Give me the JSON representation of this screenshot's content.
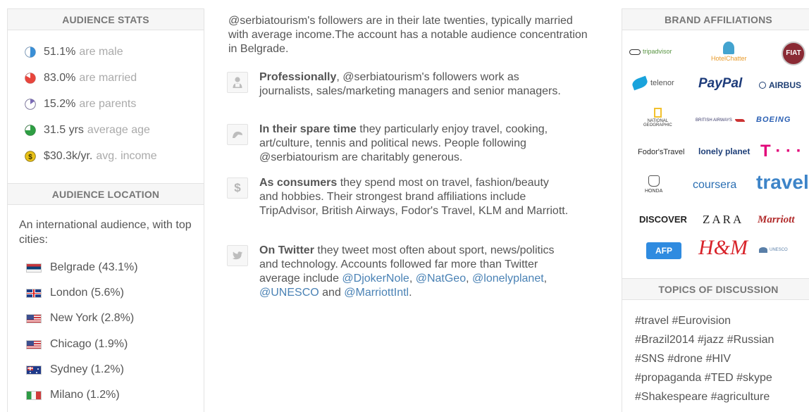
{
  "audience_stats": {
    "title": "AUDIENCE STATS",
    "items": [
      {
        "value": "51.1%",
        "label": "are male",
        "icon": "male-pie-icon",
        "fraction": 0.511,
        "color": "#3a8fd6"
      },
      {
        "value": "83.0%",
        "label": "are married",
        "icon": "married-pie-icon",
        "fraction": 0.83,
        "color": "#e8453c"
      },
      {
        "value": "15.2%",
        "label": "are parents",
        "icon": "parents-pie-icon",
        "fraction": 0.152,
        "color": "#7b6bb6"
      },
      {
        "value": "31.5 yrs",
        "label": "average age",
        "icon": "age-pie-icon",
        "fraction": 0.75,
        "color": "#2e9e43"
      },
      {
        "value": "$30.3k/yr.",
        "label": "avg. income",
        "icon": "dollar-coin-icon",
        "color": "#e9c218"
      }
    ]
  },
  "audience_location": {
    "title": "AUDIENCE LOCATION",
    "intro": "An international audience, with top cities:",
    "cities": [
      {
        "label": "Belgrade (43.1%)",
        "flag": "serbia-flag-icon"
      },
      {
        "label": "London (5.6%)",
        "flag": "uk-flag-icon"
      },
      {
        "label": "New York (2.8%)",
        "flag": "us-flag-icon"
      },
      {
        "label": "Chicago (1.9%)",
        "flag": "us-flag-icon"
      },
      {
        "label": "Sydney (1.2%)",
        "flag": "australia-flag-icon"
      },
      {
        "label": "Milano (1.2%)",
        "flag": "italy-flag-icon"
      }
    ]
  },
  "summary": "@serbiatourism's followers are in their late twenties, typically married with average income.The account has a notable audience concentration in Belgrade.",
  "insights": {
    "professional": {
      "icon": "person-icon",
      "lead": "Professionally",
      "text": ", @serbiatourism's followers work as journalists, sales/marketing managers and senior managers."
    },
    "spare_time": {
      "icon": "leisure-icon",
      "lead": "In their spare time",
      "text": " they particularly enjoy travel, cooking, art/culture, tennis and political news. People following @serbiatourism are charitably generous."
    },
    "consumers": {
      "icon": "dollar-icon",
      "icon_glyph": "$",
      "lead": "As consumers",
      "text": " they spend most on travel, fashion/beauty and hobbies. Their strongest brand affiliations include TripAdvisor, British Airways, Fodor's Travel, KLM and Marriott."
    },
    "twitter": {
      "icon": "twitter-bird-icon",
      "lead": "On Twitter",
      "text": " they tweet most often about sport, news/politics and technology. Accounts followed far more than Twitter average include ",
      "links": [
        "@DjokerNole",
        "@NatGeo",
        "@lonelyplanet",
        "@UNESCO",
        "@MarriottIntl"
      ],
      "sep1": ",",
      "sep2": ",",
      "sep3": ",",
      "and": " and",
      "end": "."
    }
  },
  "brand_affiliations": {
    "title": "BRAND AFFILIATIONS",
    "logos": {
      "tripadvisor": "tripadvisor",
      "hotelchatter": "HotelChatter",
      "fiat": "FIAT",
      "telenor": "telenor",
      "paypal": "PayPal",
      "airbus": "AIRBUS",
      "natgeo_1": "NATIONAL",
      "natgeo_2": "GEOGRAPHIC",
      "british_airways": "BRITISH AIRWAYS",
      "boeing": "BOEING",
      "fodors": "Fodor'sTravel",
      "lonely_planet": "lonely planet",
      "tmobile": "T · · ·",
      "honda": "HONDA",
      "coursera": "coursera",
      "travel": "travel",
      "discover": "DISCOVER",
      "zara": "ZARA",
      "marriott": "Marriott",
      "afp": "AFP",
      "hm": "H&M",
      "unesco_site": "UNESCO"
    },
    "colors": {
      "paypal_dark": "#1d3b7a",
      "paypal_light": "#2aa0dc",
      "tmobile": "#e2067a",
      "marriott": "#b12a2a",
      "hm": "#d8232a",
      "afp": "#2f8be0",
      "telenor": "#19a3dc",
      "boeing": "#2a5fb3"
    }
  },
  "topics": {
    "title": "TOPICS OF DISCUSSION",
    "lines": [
      "#travel #Eurovision",
      "#Brazil2014 #jazz #Russian",
      "#SNS #drone #HIV",
      "#propaganda #TED #skype",
      "#Shakespeare #agriculture"
    ]
  }
}
